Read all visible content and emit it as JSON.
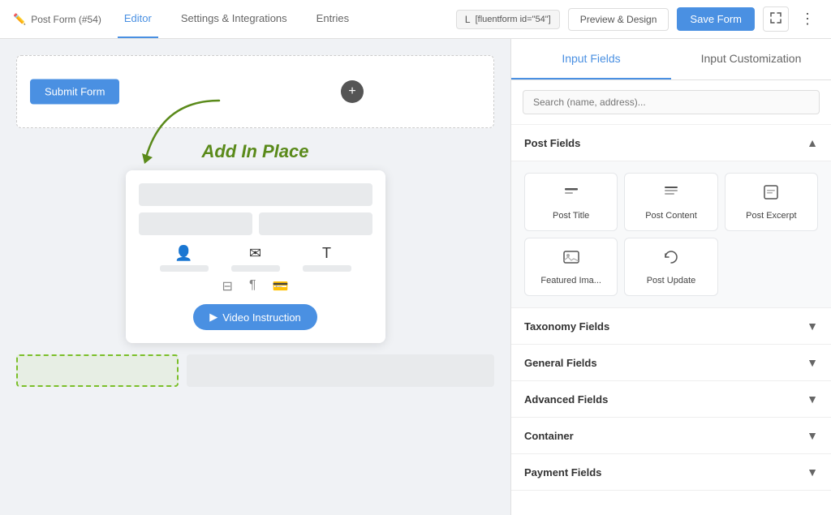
{
  "topNav": {
    "brand": "Post Form (#54)",
    "tabs": [
      {
        "label": "Editor",
        "active": true
      },
      {
        "label": "Settings & Integrations",
        "active": false
      },
      {
        "label": "Entries",
        "active": false
      }
    ],
    "shortcode": "[fluentform id=\"54\"]",
    "previewLabel": "Preview & Design",
    "saveLabel": "Save Form"
  },
  "leftPanel": {
    "submitBtnLabel": "Submit Form",
    "addInPlaceLabel": "Add In Place",
    "videoInstructionLabel": "Video Instruction"
  },
  "rightPanel": {
    "tabs": [
      {
        "label": "Input Fields",
        "active": true
      },
      {
        "label": "Input Customization",
        "active": false
      }
    ],
    "searchPlaceholder": "Search (name, address)...",
    "sections": [
      {
        "id": "post-fields",
        "label": "Post Fields",
        "open": true,
        "fields": [
          {
            "id": "post-title",
            "label": "Post Title",
            "icon": "T"
          },
          {
            "id": "post-content",
            "label": "Post Content",
            "icon": "¶"
          },
          {
            "id": "post-excerpt",
            "label": "Post Excerpt",
            "icon": "□"
          },
          {
            "id": "featured-image",
            "label": "Featured Ima...",
            "icon": "⊞"
          },
          {
            "id": "post-update",
            "label": "Post Update",
            "icon": "↻"
          }
        ]
      },
      {
        "id": "taxonomy-fields",
        "label": "Taxonomy Fields",
        "open": false
      },
      {
        "id": "general-fields",
        "label": "General Fields",
        "open": false
      },
      {
        "id": "advanced-fields",
        "label": "Advanced Fields",
        "open": false
      },
      {
        "id": "container",
        "label": "Container",
        "open": false
      },
      {
        "id": "payment-fields",
        "label": "Payment Fields",
        "open": false
      }
    ]
  }
}
